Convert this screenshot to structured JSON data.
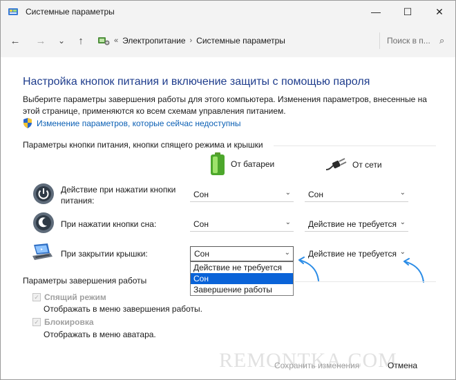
{
  "window": {
    "title": "Системные параметры",
    "controls": {
      "minimize": "—",
      "maximize": "☐",
      "close": "✕"
    }
  },
  "nav": {
    "back": "←",
    "forward": "→",
    "recent": "⌄",
    "up": "↑",
    "breadcrumb_prefix": "«",
    "breadcrumb": [
      "Электропитание",
      "Системные параметры"
    ],
    "breadcrumb_sep": "›",
    "search_placeholder": "Поиск в п...",
    "search_icon": "⌕"
  },
  "content": {
    "title": "Настройка кнопок питания и включение защиты с помощью пароля",
    "description": "Выберите параметры завершения работы для этого компьютера. Изменения параметров, внесенные на этой странице, применяются ко всем схемам управления питанием.",
    "admin_link": "Изменение параметров, которые сейчас недоступны",
    "section1_title": "Параметры кнопки питания, кнопки спящего режима и крышки",
    "col_battery": "От батареи",
    "col_ac": "От сети",
    "rows": [
      {
        "label": "Действие при нажатии кнопки питания:",
        "battery": "Сон",
        "ac": "Сон"
      },
      {
        "label": "При нажатии кнопки сна:",
        "battery": "Сон",
        "ac": "Действие не требуется"
      },
      {
        "label": "При закрытии крышки:",
        "battery": "Сон",
        "ac": "Действие не требуется"
      }
    ],
    "dropdown_options": [
      "Действие не требуется",
      "Сон",
      "Завершение работы"
    ],
    "dropdown_selected_index": 1,
    "section2_title": "Параметры завершения работы",
    "shutdown_options": [
      {
        "label": "Спящий режим",
        "description": "Отображать в меню завершения работы.",
        "checked": true
      },
      {
        "label": "Блокировка",
        "description": "Отображать в меню аватара.",
        "checked": true
      }
    ],
    "check_mark": "✓",
    "chevron": "⌄"
  },
  "footer": {
    "save": "Сохранить изменения",
    "cancel": "Отмена"
  },
  "watermark": "REMONTKA.COM",
  "colors": {
    "title_blue": "#1e3c8c",
    "link_blue": "#0a5fb4",
    "selection_blue": "#0a63d8",
    "arrow_blue": "#2b8ce6"
  }
}
